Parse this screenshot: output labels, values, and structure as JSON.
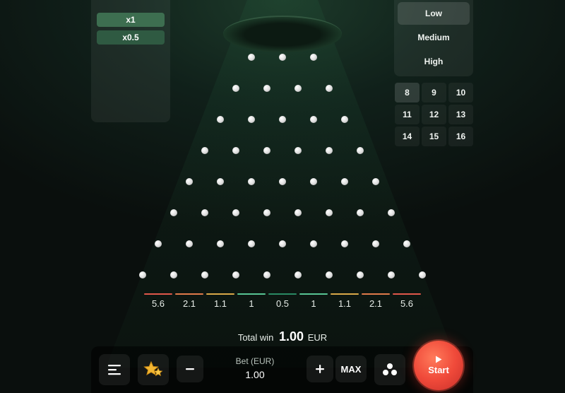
{
  "multipliers": [
    "x1",
    "x0.5"
  ],
  "risk": {
    "options": [
      "Low",
      "Medium",
      "High"
    ],
    "selected": "Low"
  },
  "rows": {
    "options": [
      "8",
      "9",
      "10",
      "11",
      "12",
      "13",
      "14",
      "15",
      "16"
    ],
    "selected": "8"
  },
  "buckets": [
    {
      "label": "5.6",
      "color": "#e0574a"
    },
    {
      "label": "2.1",
      "color": "#e07a4a"
    },
    {
      "label": "1.1",
      "color": "#d9a848"
    },
    {
      "label": "1",
      "color": "#57c493"
    },
    {
      "label": "0.5",
      "color": "#2a8a64"
    },
    {
      "label": "1",
      "color": "#57c493"
    },
    {
      "label": "1.1",
      "color": "#d9a848"
    },
    {
      "label": "2.1",
      "color": "#e07a4a"
    },
    {
      "label": "5.6",
      "color": "#e0574a"
    }
  ],
  "total_win": {
    "label": "Total win",
    "amount": "1.00",
    "currency": "EUR"
  },
  "bet": {
    "label": "Bet (EUR)",
    "value": "1.00",
    "max_label": "MAX"
  },
  "controls": {
    "menu_icon": "menu-icon",
    "favorite_icon": "stars-icon",
    "minus_icon": "minus-icon",
    "plus_icon": "plus-icon",
    "autoplay_icon": "balls-icon",
    "start_label": "Start"
  },
  "colors": {
    "start": "#f04a3a",
    "accent_green": "#3d6e50"
  }
}
